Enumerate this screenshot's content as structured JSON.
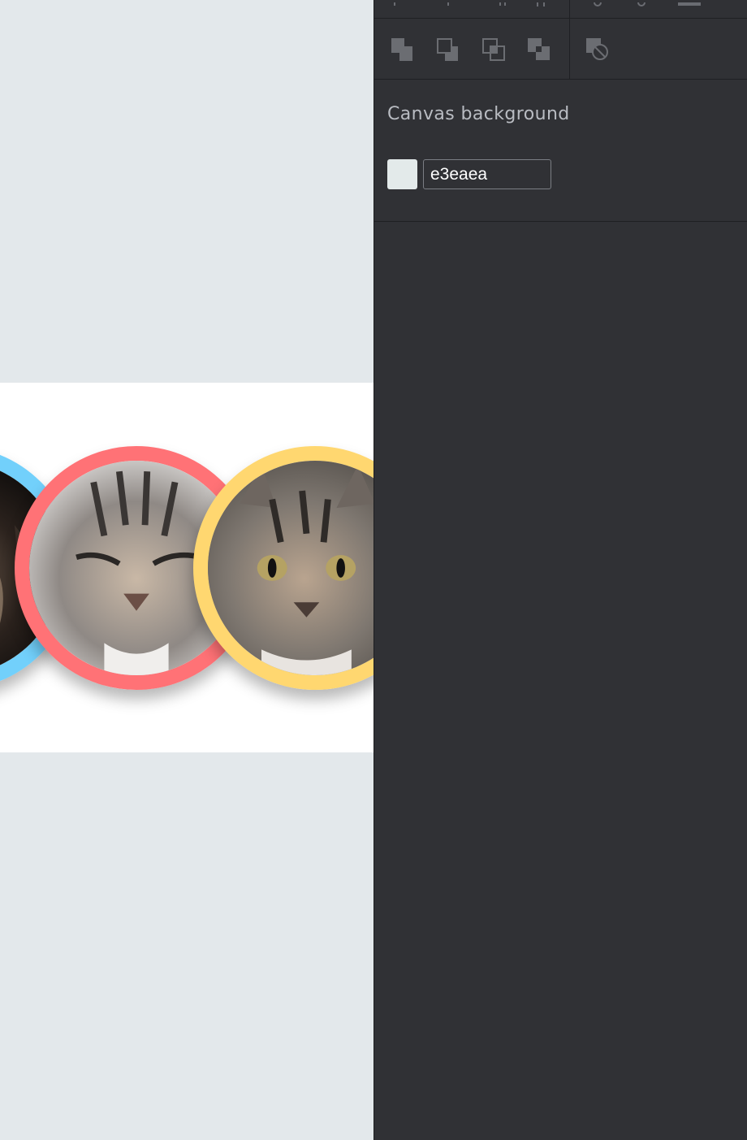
{
  "canvas": {
    "artboard": {
      "avatars": [
        {
          "name": "cat-avatar-blue",
          "ring_color": "#72d0fb"
        },
        {
          "name": "cat-avatar-red",
          "ring_color": "#ff7276"
        },
        {
          "name": "cat-avatar-yellow",
          "ring_color": "#ffd770"
        }
      ]
    }
  },
  "inspector": {
    "toolbar": {
      "boolean_ops": [
        {
          "name": "union-icon"
        },
        {
          "name": "subtract-icon"
        },
        {
          "name": "intersect-icon"
        },
        {
          "name": "difference-icon"
        },
        {
          "name": "flatten-icon"
        }
      ]
    },
    "canvas_background": {
      "title": "Canvas background",
      "color_value": "e3eaea",
      "swatch_color": "#e3eaea"
    }
  },
  "colors": {
    "panel_bg": "#303135",
    "canvas_bg": "#e3e8eb",
    "text_muted": "#b9bcc2"
  }
}
